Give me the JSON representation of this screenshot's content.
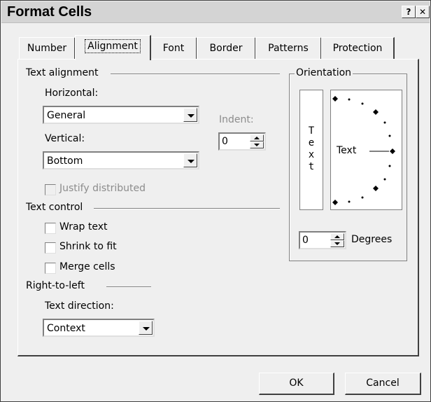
{
  "window": {
    "title": "Format Cells",
    "help_glyph": "?",
    "close_glyph": "✕"
  },
  "tabs": [
    {
      "label": "Number"
    },
    {
      "label": "Alignment",
      "selected": true
    },
    {
      "label": "Font"
    },
    {
      "label": "Border"
    },
    {
      "label": "Patterns"
    },
    {
      "label": "Protection"
    }
  ],
  "text_alignment": {
    "heading": "Text alignment",
    "horizontal_label": "Horizontal:",
    "horizontal_value": "General",
    "vertical_label": "Vertical:",
    "vertical_value": "Bottom",
    "indent_label": "Indent:",
    "indent_value": "0",
    "justify_distributed": "Justify distributed"
  },
  "text_control": {
    "heading": "Text control",
    "wrap_text": "Wrap text",
    "shrink_to_fit": "Shrink to fit",
    "merge_cells": "Merge cells"
  },
  "right_to_left": {
    "heading": "Right-to-left",
    "direction_label": "Text direction:",
    "direction_value": "Context"
  },
  "orientation": {
    "heading": "Orientation",
    "vertical_letters": [
      "T",
      "e",
      "x",
      "t"
    ],
    "dial_text": "Text",
    "degrees_value": "0",
    "degrees_label": "Degrees"
  },
  "buttons": {
    "ok": "OK",
    "cancel": "Cancel"
  }
}
